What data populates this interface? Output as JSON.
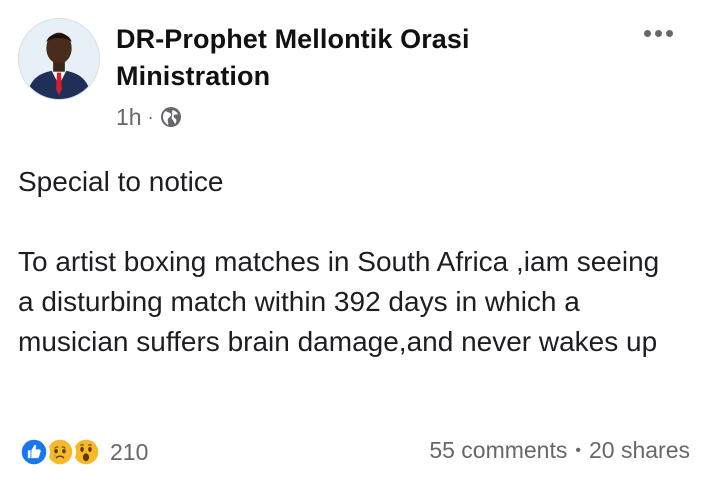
{
  "post": {
    "author": "DR-Prophet Mellontik Orasi Ministration",
    "timestamp": "1h",
    "separator": "·",
    "privacy_icon": "globe-icon",
    "text_line1": "Special to notice",
    "text_line2": "To artist boxing matches in South Africa ,iam seeing a disturbing match within 392 days in which a musician suffers brain damage,and never wakes up"
  },
  "reactions": {
    "icons": [
      "like-icon",
      "sad-icon",
      "wow-icon"
    ],
    "count": "210"
  },
  "stats": {
    "comments": "55 comments",
    "separator": "•",
    "shares": "20 shares"
  },
  "colors": {
    "like": "#1877f2",
    "emoji": "#f7b928",
    "secondary_text": "#65676b"
  }
}
